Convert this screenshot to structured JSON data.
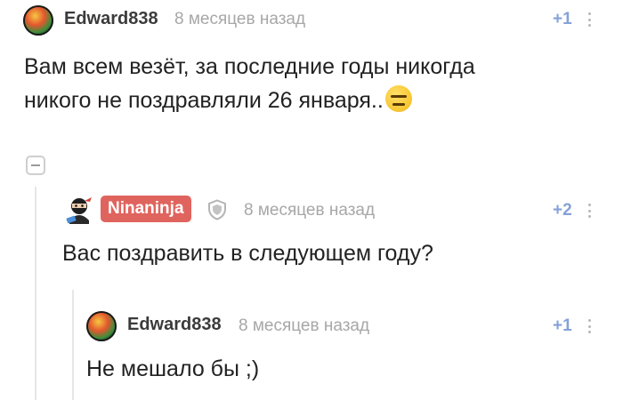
{
  "comments": [
    {
      "username": "Edward838",
      "time": "8 месяцев назад",
      "rating": "+1",
      "text_lines": [
        "Вам всем везёт, за последние годы никогда",
        "никого не поздравляли 26 января.."
      ],
      "emoji": "expressionless-face-emoji"
    },
    {
      "username": "Ninaninja",
      "time": "8 месяцев назад",
      "rating": "+2",
      "text": "Вас поздравить в следующем году?",
      "icons": [
        "ninja-avatar-icon",
        "shield-icon"
      ]
    },
    {
      "username": "Edward838",
      "time": "8 месяцев назад",
      "rating": "+1",
      "text": "Не мешало бы ;)"
    }
  ],
  "colors": {
    "badge": "#e0645e",
    "rating": "#86a1d8",
    "meta": "#a7a7a7",
    "thread_line": "#e6e6e6"
  }
}
